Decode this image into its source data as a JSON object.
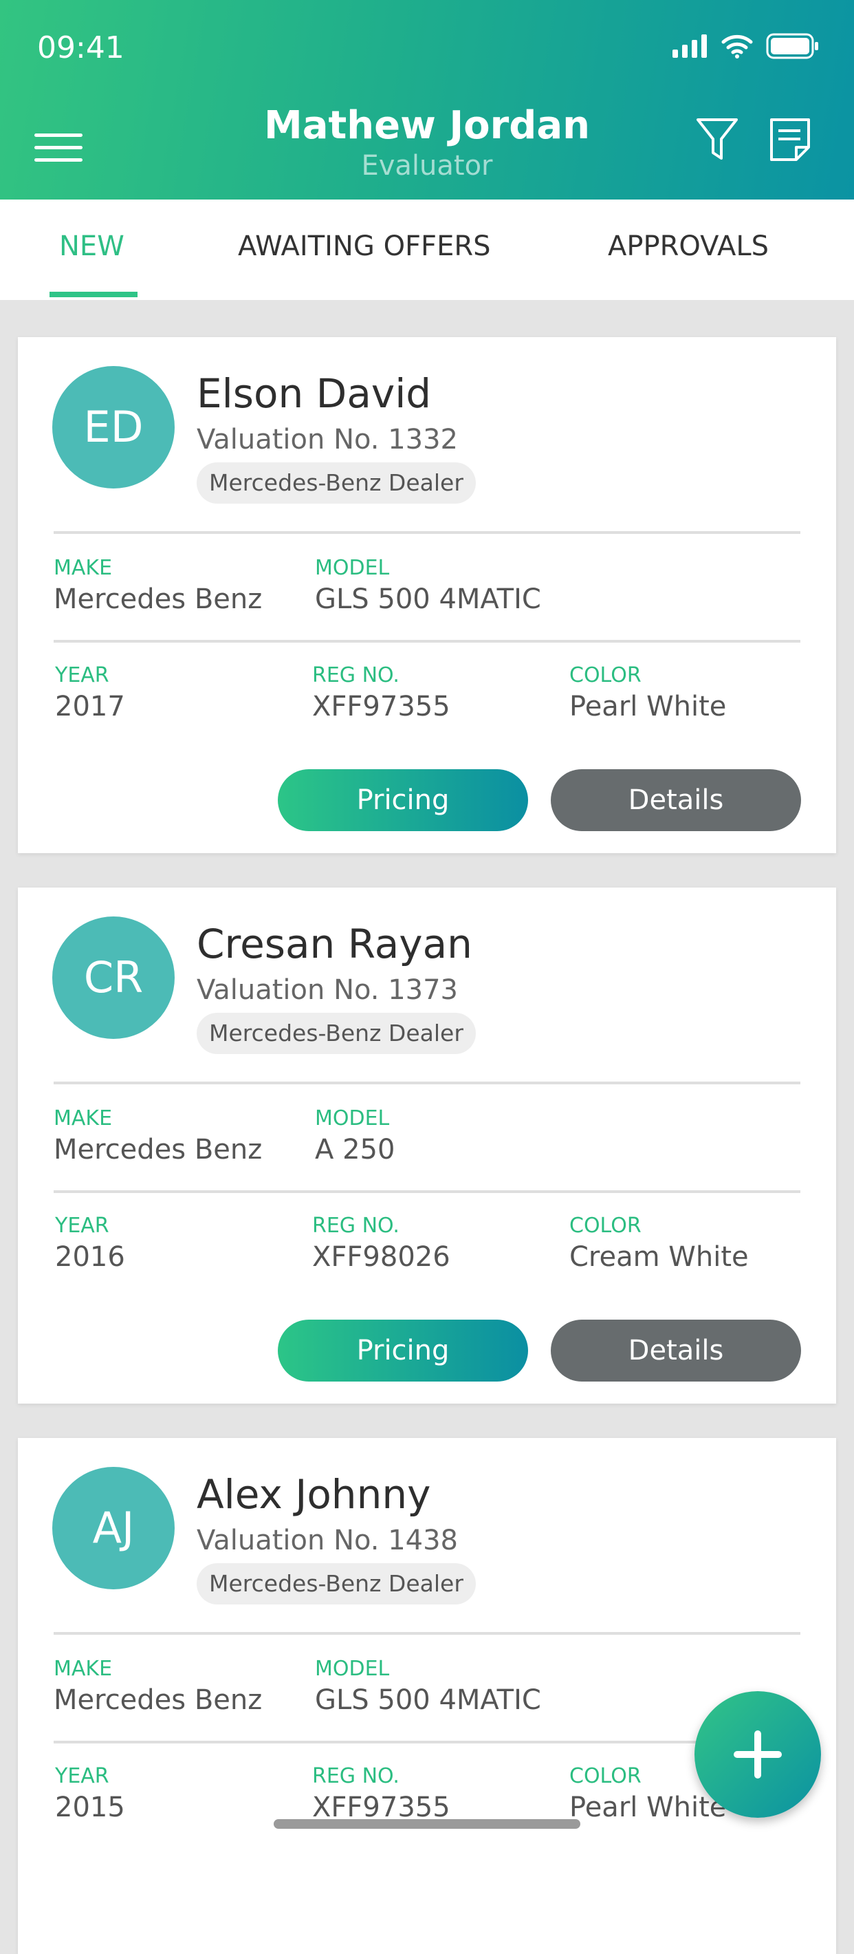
{
  "status_bar": {
    "time": "09:41"
  },
  "header": {
    "title": "Mathew Jordan",
    "subtitle": "Evaluator",
    "icons": [
      "menu-icon",
      "filter-icon",
      "notes-icon"
    ]
  },
  "tabs": [
    {
      "label": "NEW",
      "active": true
    },
    {
      "label": "AWAITING OFFERS",
      "active": false
    },
    {
      "label": "APPROVALS",
      "active": false
    }
  ],
  "field_labels": {
    "make": "MAKE",
    "model": "MODEL",
    "year": "YEAR",
    "reg": "REG NO.",
    "color": "COLOR"
  },
  "buttons": {
    "pricing": "Pricing",
    "details": "Details"
  },
  "cards": [
    {
      "initials": "ED",
      "name": "Elson David",
      "valuation": "Valuation No. 1332",
      "dealer": "Mercedes-Benz Dealer",
      "make": "Mercedes Benz",
      "model": "GLS 500 4MATIC",
      "year": "2017",
      "reg": "XFF97355",
      "color": "Pearl White"
    },
    {
      "initials": "CR",
      "name": "Cresan Rayan",
      "valuation": "Valuation No. 1373",
      "dealer": "Mercedes-Benz Dealer",
      "make": "Mercedes Benz",
      "model": "A 250",
      "year": "2016",
      "reg": "XFF98026",
      "color": "Cream White"
    },
    {
      "initials": "AJ",
      "name": "Alex Johnny",
      "valuation": "Valuation No. 1438",
      "dealer": "Mercedes-Benz Dealer",
      "make": "Mercedes Benz",
      "model": "GLS 500 4MATIC",
      "year": "2015",
      "reg": "XFF97355",
      "color": "Pearl White"
    }
  ],
  "fab": {
    "icon": "plus-icon"
  },
  "colors": {
    "accent_green": "#2fbf85",
    "accent_teal": "#0b93a3",
    "avatar": "#4cbbb6",
    "details_button": "#676c6e"
  }
}
